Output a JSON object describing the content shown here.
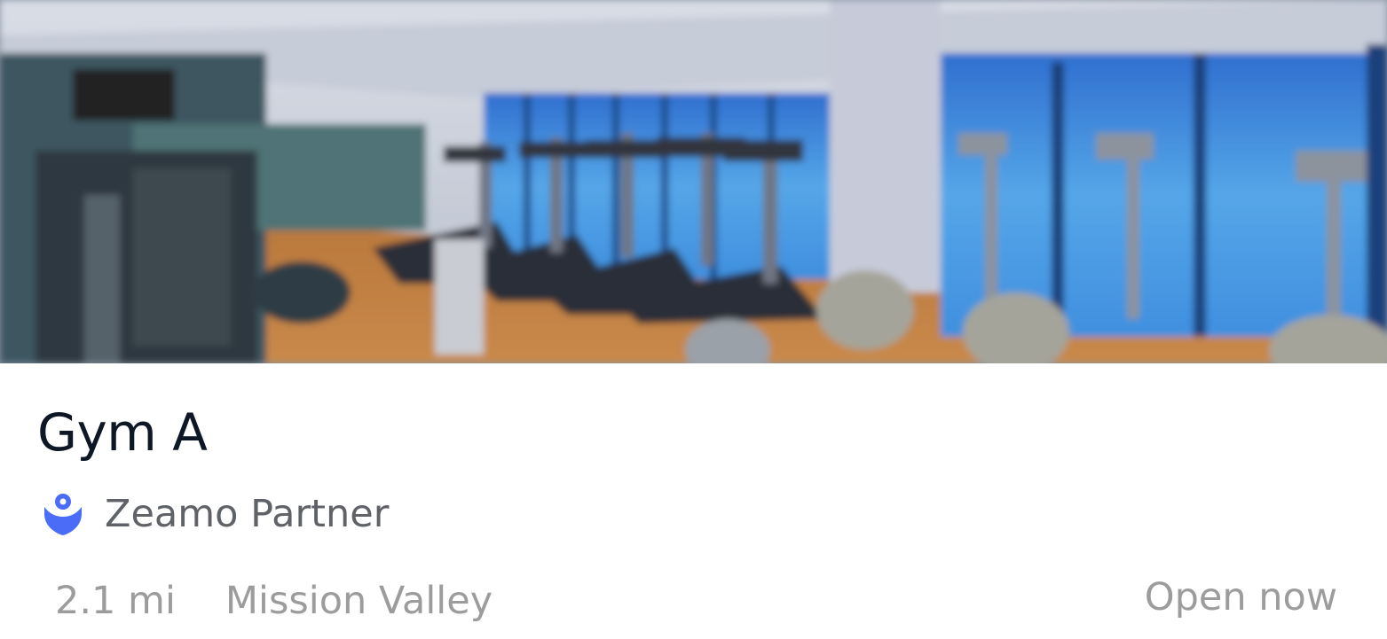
{
  "gym": {
    "name": "Gym A",
    "partner_label": "Zeamo Partner",
    "partner_icon": "zeamo-partner-badge-icon",
    "distance": "2.1 mi",
    "neighborhood": "Mission Valley",
    "status": "Open now"
  },
  "colors": {
    "title": "#0d1726",
    "partner_text": "#5f6368",
    "meta_text": "#9c9c9c",
    "badge_blue": "#4a6cf7",
    "background": "#ffffff"
  }
}
